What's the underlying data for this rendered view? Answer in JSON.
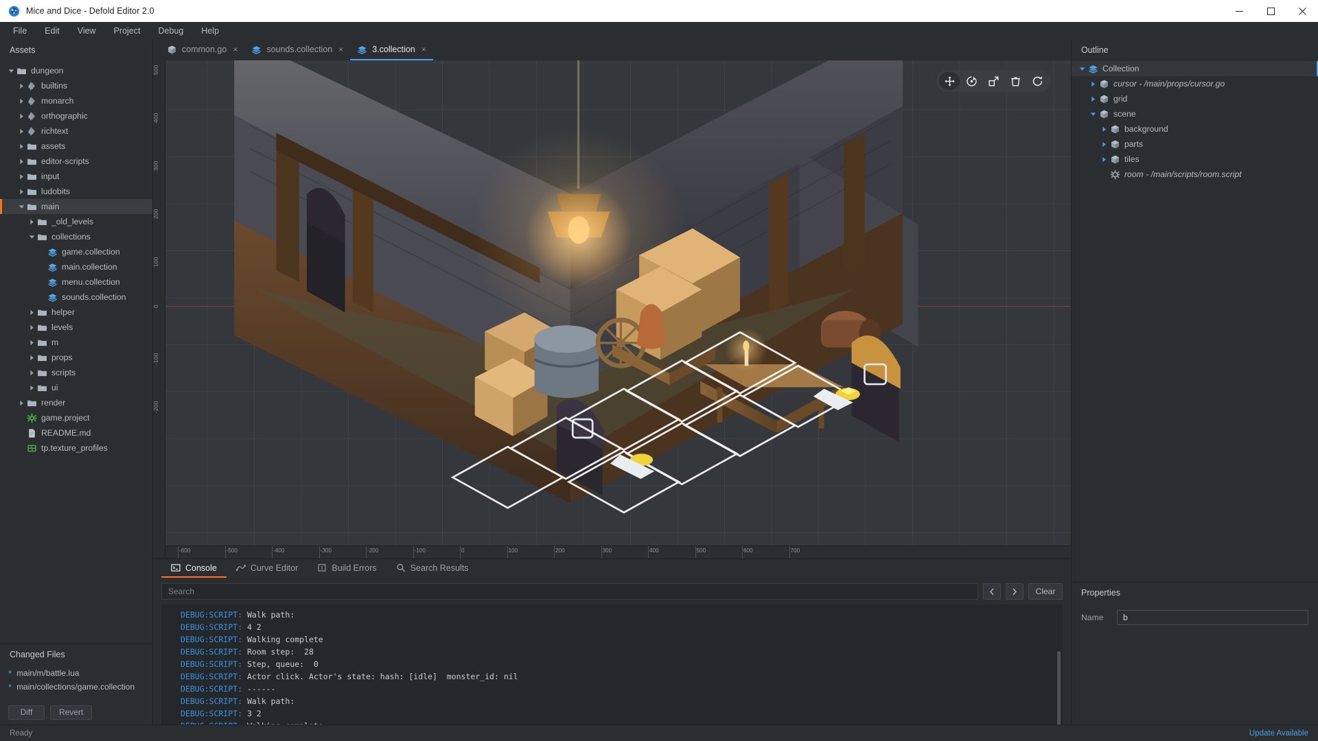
{
  "window": {
    "title": "Mice and Dice - Defold Editor 2.0",
    "app_icon": "defold-logo-icon",
    "minimize": "minimize-icon",
    "maximize": "maximize-icon",
    "close": "close-icon"
  },
  "menubar": {
    "items": [
      "File",
      "Edit",
      "View",
      "Project",
      "Debug",
      "Help"
    ]
  },
  "assets": {
    "header": "Assets",
    "tree": [
      {
        "label": "dungeon",
        "depth": 0,
        "icon": "folder-icon",
        "twisty": "open",
        "selected": false
      },
      {
        "label": "builtins",
        "depth": 1,
        "icon": "puzzle-icon",
        "twisty": "closed",
        "selected": false
      },
      {
        "label": "monarch",
        "depth": 1,
        "icon": "puzzle-icon",
        "twisty": "closed",
        "selected": false
      },
      {
        "label": "orthographic",
        "depth": 1,
        "icon": "puzzle-icon",
        "twisty": "closed",
        "selected": false
      },
      {
        "label": "richtext",
        "depth": 1,
        "icon": "puzzle-icon",
        "twisty": "closed",
        "selected": false
      },
      {
        "label": "assets",
        "depth": 1,
        "icon": "folder-icon",
        "twisty": "closed",
        "selected": false
      },
      {
        "label": "editor-scripts",
        "depth": 1,
        "icon": "folder-icon",
        "twisty": "closed",
        "selected": false
      },
      {
        "label": "input",
        "depth": 1,
        "icon": "folder-icon",
        "twisty": "closed",
        "selected": false
      },
      {
        "label": "ludobits",
        "depth": 1,
        "icon": "folder-icon",
        "twisty": "closed",
        "selected": false
      },
      {
        "label": "main",
        "depth": 1,
        "icon": "folder-icon",
        "twisty": "open",
        "selected": true
      },
      {
        "label": "_old_levels",
        "depth": 2,
        "icon": "folder-icon",
        "twisty": "closed",
        "selected": false
      },
      {
        "label": "collections",
        "depth": 2,
        "icon": "folder-icon",
        "twisty": "open",
        "selected": false
      },
      {
        "label": "game.collection",
        "depth": 3,
        "icon": "collection-icon",
        "twisty": "none",
        "selected": false
      },
      {
        "label": "main.collection",
        "depth": 3,
        "icon": "collection-icon",
        "twisty": "none",
        "selected": false
      },
      {
        "label": "menu.collection",
        "depth": 3,
        "icon": "collection-icon",
        "twisty": "none",
        "selected": false
      },
      {
        "label": "sounds.collection",
        "depth": 3,
        "icon": "collection-icon",
        "twisty": "none",
        "selected": false
      },
      {
        "label": "helper",
        "depth": 2,
        "icon": "folder-icon",
        "twisty": "closed",
        "selected": false
      },
      {
        "label": "levels",
        "depth": 2,
        "icon": "folder-icon",
        "twisty": "closed",
        "selected": false
      },
      {
        "label": "m",
        "depth": 2,
        "icon": "folder-icon",
        "twisty": "closed",
        "selected": false
      },
      {
        "label": "props",
        "depth": 2,
        "icon": "folder-icon",
        "twisty": "closed",
        "selected": false
      },
      {
        "label": "scripts",
        "depth": 2,
        "icon": "folder-icon",
        "twisty": "closed",
        "selected": false
      },
      {
        "label": "ui",
        "depth": 2,
        "icon": "folder-icon",
        "twisty": "closed",
        "selected": false
      },
      {
        "label": "render",
        "depth": 1,
        "icon": "folder-icon",
        "twisty": "closed",
        "selected": false
      },
      {
        "label": "game.project",
        "depth": 1,
        "icon": "gameproject-icon",
        "twisty": "none",
        "selected": false
      },
      {
        "label": "README.md",
        "depth": 1,
        "icon": "document-icon",
        "twisty": "none",
        "selected": false
      },
      {
        "label": "tp.texture_profiles",
        "depth": 1,
        "icon": "texture-icon",
        "twisty": "none",
        "selected": false
      }
    ]
  },
  "changed_files": {
    "header": "Changed Files",
    "items": [
      {
        "marker": "*",
        "path": "main/m/battle.lua"
      },
      {
        "marker": "*",
        "path": "main/collections/game.collection"
      }
    ],
    "diff_label": "Diff",
    "revert_label": "Revert"
  },
  "editor_tabs": [
    {
      "label": "common.go",
      "icon": "gameobject-icon",
      "active": false,
      "close": "×"
    },
    {
      "label": "sounds.collection",
      "icon": "collection-icon",
      "active": false,
      "close": "×"
    },
    {
      "label": "3.collection",
      "icon": "collection-icon",
      "active": true,
      "close": "×"
    }
  ],
  "viewport": {
    "toolbar": [
      {
        "name": "move-tool",
        "selected": true
      },
      {
        "name": "rotate-tool",
        "selected": false
      },
      {
        "name": "scale-tool",
        "selected": false
      },
      {
        "name": "delete-tool",
        "selected": false
      },
      {
        "name": "reload-tool",
        "selected": false
      }
    ],
    "ruler_x_ticks": [
      "-600",
      "-500",
      "-400",
      "-300",
      "-200",
      "-100",
      "0",
      "100",
      "200",
      "300",
      "400",
      "500",
      "600",
      "700"
    ],
    "ruler_y_ticks": [
      "500",
      "400",
      "300",
      "200",
      "100",
      "0",
      "-100",
      "-200"
    ]
  },
  "dock": {
    "tabs": [
      {
        "label": "Console",
        "icon": "terminal-icon",
        "active": true
      },
      {
        "label": "Curve Editor",
        "icon": "curve-icon",
        "active": false
      },
      {
        "label": "Build Errors",
        "icon": "warning-icon",
        "active": false
      },
      {
        "label": "Search Results",
        "icon": "search-icon",
        "active": false
      }
    ],
    "search_placeholder": "Search",
    "search_value": "",
    "prev_label": "‹",
    "next_label": "›",
    "clear_label": "Clear",
    "log_tag": "DEBUG:SCRIPT:",
    "log_lines": [
      "Walk path:",
      "4 2",
      "Walking complete",
      "Room step:  28",
      "Step, queue:  0",
      "Actor click. Actor's state: hash: [idle]  monster_id: nil",
      "------",
      "Walk path:",
      "3 2",
      "Walking complete"
    ]
  },
  "outline": {
    "header": "Outline",
    "tree": [
      {
        "label": "Collection",
        "depth": 0,
        "icon": "collection-icon",
        "twisty": "open",
        "italic": false,
        "selected": true
      },
      {
        "label": "cursor - /main/props/cursor.go",
        "depth": 1,
        "icon": "gameobject-icon",
        "twisty": "closed",
        "italic": true,
        "selected": false
      },
      {
        "label": "grid",
        "depth": 1,
        "icon": "gameobject-icon",
        "twisty": "closed",
        "italic": false,
        "selected": false
      },
      {
        "label": "scene",
        "depth": 1,
        "icon": "gameobject-icon",
        "twisty": "open",
        "italic": false,
        "selected": false
      },
      {
        "label": "background",
        "depth": 2,
        "icon": "gameobject-icon",
        "twisty": "closed",
        "italic": false,
        "selected": false
      },
      {
        "label": "parts",
        "depth": 2,
        "icon": "gameobject-icon",
        "twisty": "closed",
        "italic": false,
        "selected": false
      },
      {
        "label": "tiles",
        "depth": 2,
        "icon": "gameobject-icon",
        "twisty": "closed",
        "italic": false,
        "selected": false
      },
      {
        "label": "room - /main/scripts/room.script",
        "depth": 2,
        "icon": "script-icon",
        "twisty": "none",
        "italic": true,
        "selected": false
      }
    ]
  },
  "properties": {
    "header": "Properties",
    "name_label": "Name",
    "name_value": "b"
  },
  "statusbar": {
    "left": "Ready",
    "update": "Update Available"
  },
  "colors": {
    "accent_orange": "#ff7216",
    "accent_blue": "#4d9ee6",
    "bg": "#2b2e31",
    "panel": "#25282b"
  }
}
